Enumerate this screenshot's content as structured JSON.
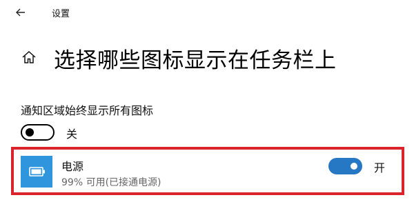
{
  "header": {
    "title": "设置",
    "back_icon": "back-arrow-icon"
  },
  "page": {
    "title": "选择哪些图标显示在任务栏上",
    "home_icon": "home-icon"
  },
  "notification_area": {
    "label": "通知区域始终显示所有图标",
    "toggle_state": "off",
    "toggle_label": "关"
  },
  "items": [
    {
      "name": "电源",
      "status": "99% 可用(已接通电源)",
      "icon": "battery-icon",
      "icon_color": "#2f95dc",
      "toggle_state": "on",
      "toggle_label": "开"
    }
  ],
  "colors": {
    "accent": "#2677c4",
    "highlight_border": "#d9242b"
  }
}
